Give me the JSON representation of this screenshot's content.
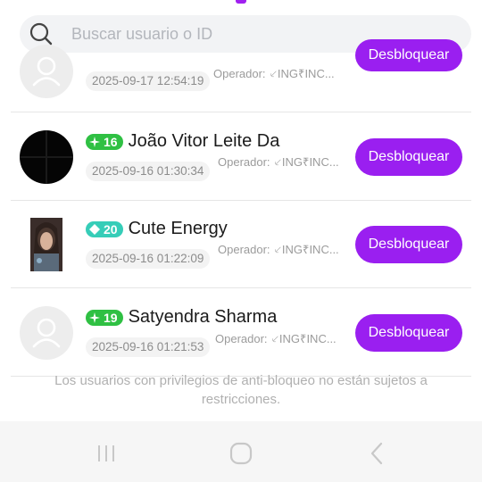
{
  "search": {
    "placeholder": "Buscar usuario o ID"
  },
  "list": {
    "unblock_label": "Desbloquear",
    "rows": [
      {
        "name": "",
        "level": "",
        "operator": "Operador: ⸔ING₹INC...",
        "timestamp": "2025-09-17 12:54:19",
        "avatar": "placeholder-avatar-icon"
      },
      {
        "name": "João Vitor Leite Da",
        "level": "16",
        "operator": "Operador: ⸔ING₹INC...",
        "timestamp": "2025-09-16 01:30:34",
        "avatar": "dark-avatar"
      },
      {
        "name": "Cute Energy",
        "level": "20",
        "operator": "Operador: ⸔ING₹INC...",
        "timestamp": "2025-09-16 01:22:09",
        "avatar": "photo-avatar"
      },
      {
        "name": "Satyendra Sharma",
        "level": "19",
        "operator": "Operador: ⸔ING₹INC...",
        "timestamp": "2025-09-16 01:21:53",
        "avatar": "placeholder-avatar-icon"
      }
    ]
  },
  "footer_note": "Los usuarios con privilegios de anti-bloqueo no están sujetos a restricciones.",
  "colors": {
    "accent": "#9a1ff0",
    "badge_green": "#2fc043",
    "badge_teal": "#36cdb8"
  },
  "navbar": {
    "recent_icon": "recent-apps-icon",
    "home_icon": "home-icon",
    "back_icon": "back-icon"
  }
}
